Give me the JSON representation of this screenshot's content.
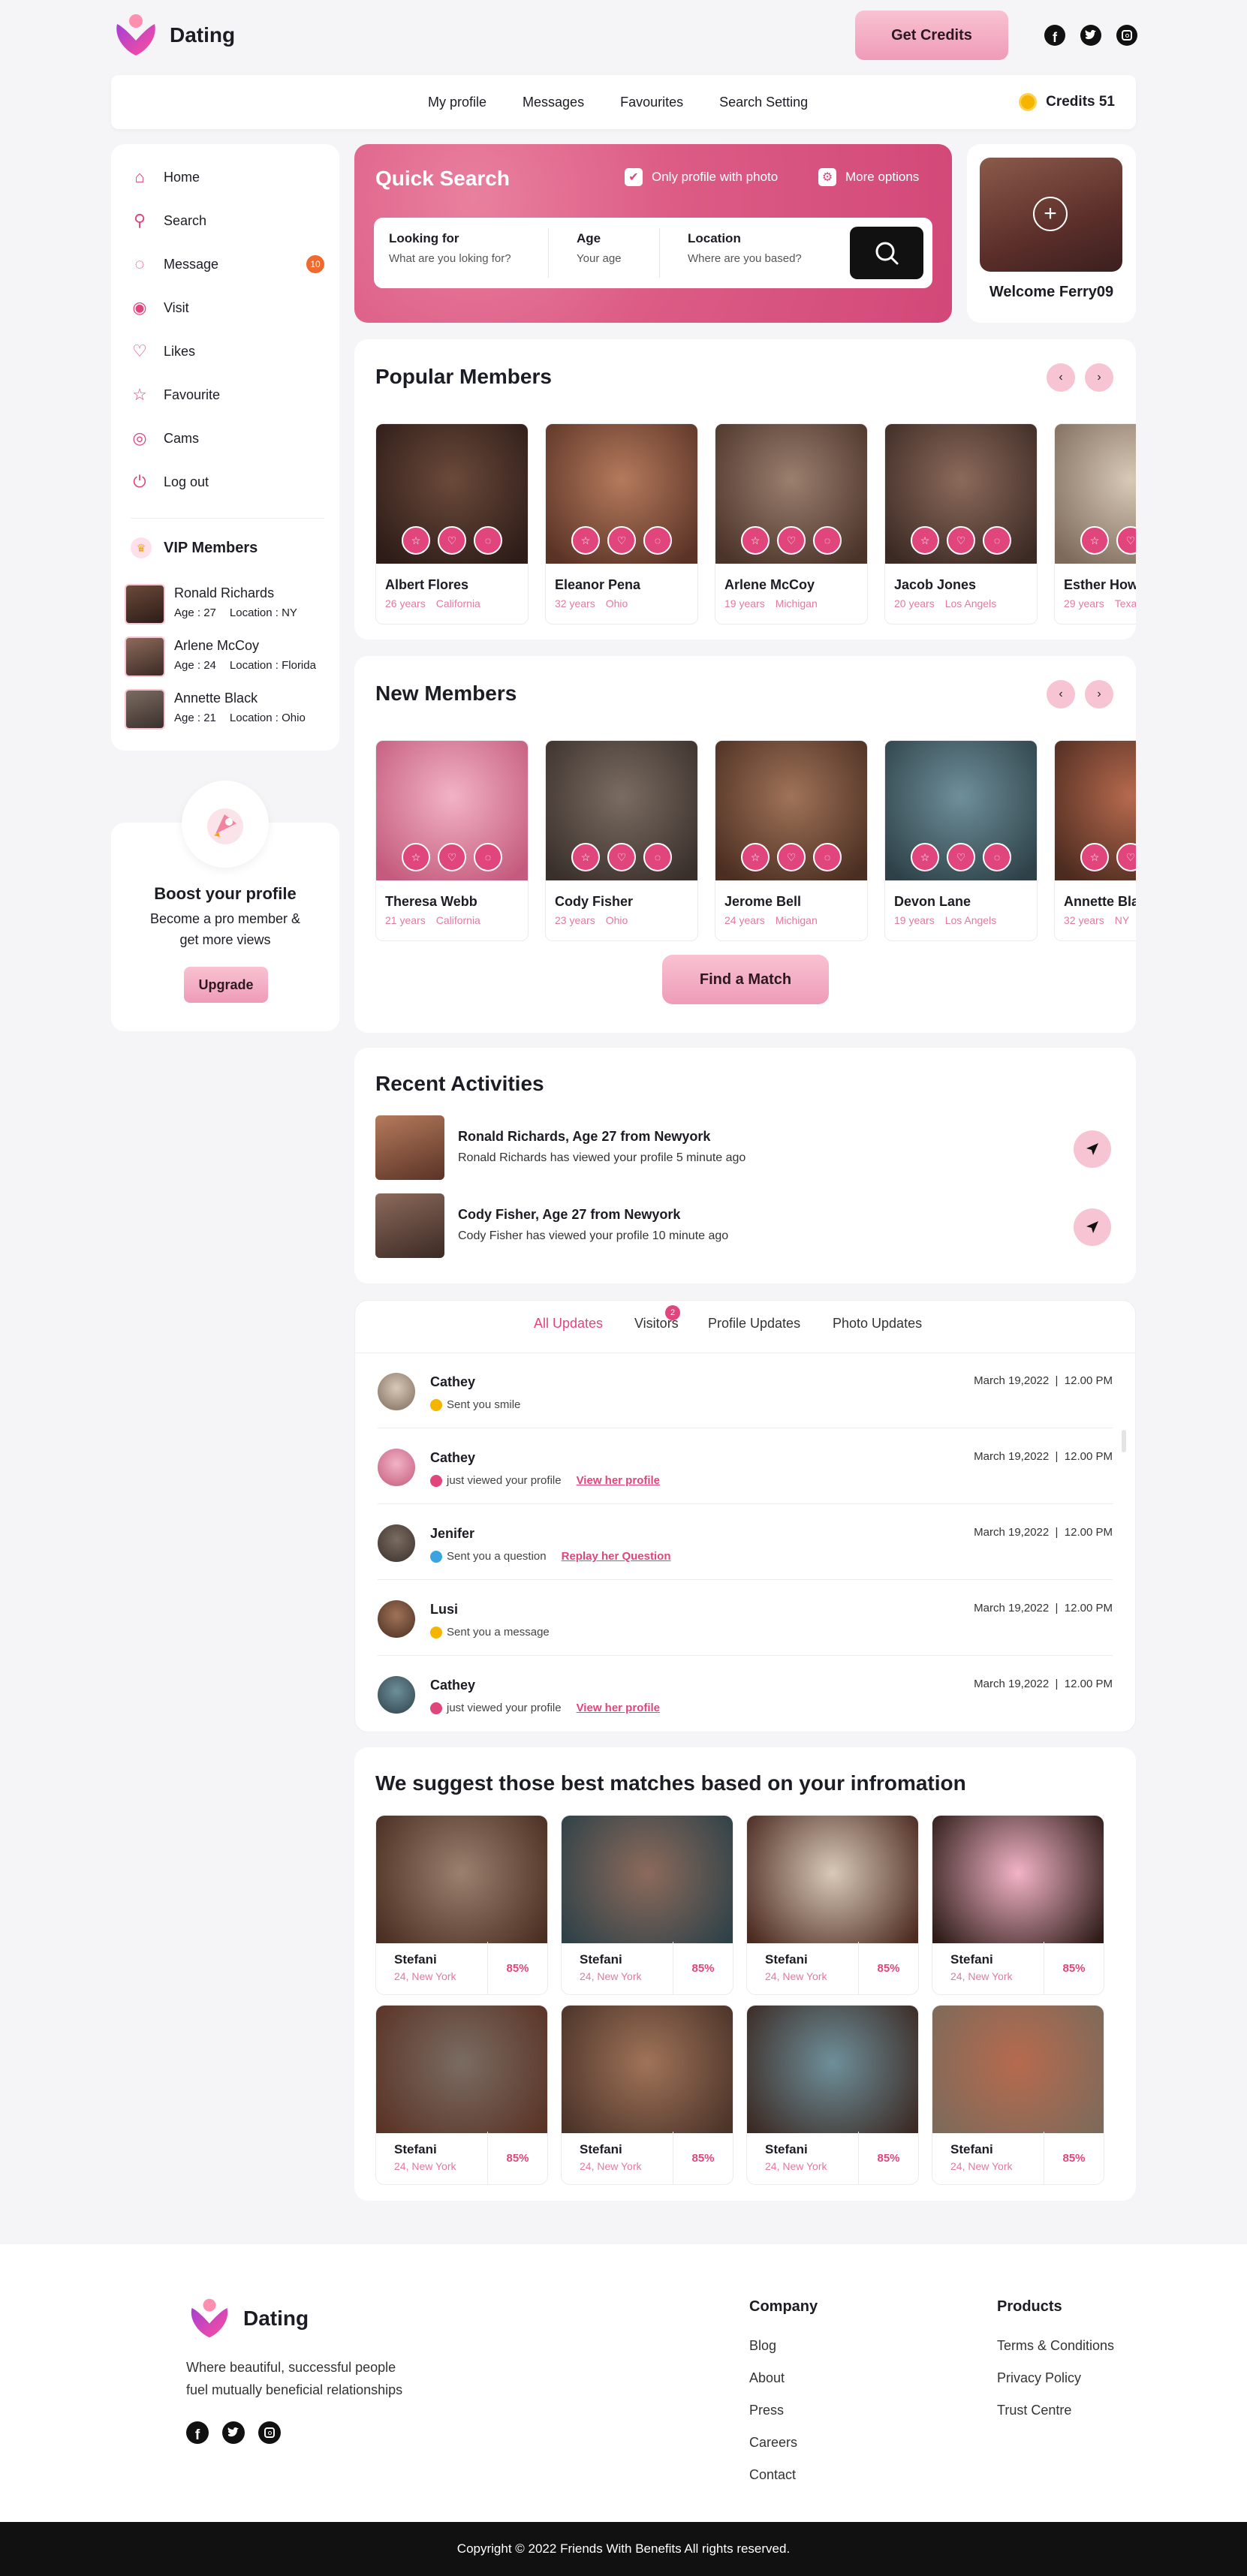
{
  "brand": {
    "name": "Dating"
  },
  "header": {
    "get_credits": "Get Credits",
    "social": [
      "facebook-icon",
      "twitter-icon",
      "instagram-icon"
    ]
  },
  "topnav": {
    "items": [
      "My profile",
      "Messages",
      "Favourites",
      "Search Setting"
    ],
    "credits": "Credits 51"
  },
  "sidebar": {
    "items": [
      {
        "label": "Home",
        "icon": "home-icon"
      },
      {
        "label": "Search",
        "icon": "search-icon"
      },
      {
        "label": "Message",
        "icon": "message-icon",
        "badge": "10"
      },
      {
        "label": "Visit",
        "icon": "eye-icon"
      },
      {
        "label": "Likes",
        "icon": "heart-icon"
      },
      {
        "label": "Favourite",
        "icon": "star-icon"
      },
      {
        "label": "Cams",
        "icon": "webcam-icon"
      },
      {
        "label": "Log out",
        "icon": "power-icon"
      }
    ],
    "vip_title": "VIP Members",
    "vip": [
      {
        "name": "Ronald Richards",
        "age": "Age : 27",
        "location": "Location : NY"
      },
      {
        "name": "Arlene McCoy",
        "age": "Age : 24",
        "location": "Location : Florida"
      },
      {
        "name": "Annette Black",
        "age": "Age : 21",
        "location": "Location : Ohio"
      }
    ]
  },
  "boost": {
    "title": "Boost your profile",
    "text1": "Become a pro member &",
    "text2": "get more views",
    "button": "Upgrade"
  },
  "quick_search": {
    "title": "Quick Search",
    "only_photo": "Only profile with photo",
    "more_options": "More options",
    "looking_label": "Looking for",
    "looking_placeholder": "What are you loking for?",
    "age_label": "Age",
    "age_placeholder": "Your age",
    "location_label": "Location",
    "location_placeholder": "Where are you based?"
  },
  "welcome": {
    "text": "Welcome Ferry09"
  },
  "popular": {
    "title": "Popular Members",
    "members": [
      {
        "name": "Albert Flores",
        "age": "26 years",
        "loc": "California"
      },
      {
        "name": "Eleanor Pena",
        "age": "32 years",
        "loc": "Ohio"
      },
      {
        "name": "Arlene McCoy",
        "age": "19 years",
        "loc": "Michigan"
      },
      {
        "name": "Jacob Jones",
        "age": "20 years",
        "loc": "Los Angels"
      },
      {
        "name": "Esther Howard",
        "age": "29 years",
        "loc": "Texas"
      }
    ]
  },
  "new_members": {
    "title": "New Members",
    "members": [
      {
        "name": "Theresa Webb",
        "age": "21 years",
        "loc": "California"
      },
      {
        "name": "Cody Fisher",
        "age": "23 years",
        "loc": "Ohio"
      },
      {
        "name": "Jerome Bell",
        "age": "24 years",
        "loc": "Michigan"
      },
      {
        "name": "Devon Lane",
        "age": "19 years",
        "loc": "Los Angels"
      },
      {
        "name": "Annette Black",
        "age": "32 years",
        "loc": "NY"
      }
    ],
    "find_match": "Find a Match"
  },
  "recent": {
    "title": "Recent Activities",
    "items": [
      {
        "title": "Ronald Richards, Age 27 from Newyork",
        "text": "Ronald Richards has viewed your profile 5 minute ago"
      },
      {
        "title": "Cody Fisher, Age 27 from Newyork",
        "text": "Cody Fisher has viewed your profile 10 minute ago"
      }
    ]
  },
  "updates": {
    "tabs": [
      "All Updates",
      "Visitors",
      "Profile Updates",
      "Photo Updates"
    ],
    "visitors_badge": "2",
    "items": [
      {
        "name": "Cathey",
        "text": "Sent you smile",
        "link": "",
        "date": "March 19,2022  |  12.00 PM"
      },
      {
        "name": "Cathey",
        "text": "just viewed your profile",
        "link": "View her profile",
        "date": "March 19,2022  |  12.00 PM"
      },
      {
        "name": "Jenifer",
        "text": "Sent you a question",
        "link": "Replay her Question",
        "date": "March 19,2022  |  12.00 PM"
      },
      {
        "name": "Lusi",
        "text": "Sent you a message",
        "link": "",
        "date": "March 19,2022  |  12.00 PM"
      },
      {
        "name": "Cathey",
        "text": "just viewed your profile",
        "link": "View her profile",
        "date": "March 19,2022  |  12.00 PM"
      }
    ]
  },
  "suggest": {
    "title": "We suggest those best matches based on your infromation",
    "items": [
      {
        "name": "Stefani",
        "place": "24, New York",
        "match": "85%"
      },
      {
        "name": "Stefani",
        "place": "24, New York",
        "match": "85%"
      },
      {
        "name": "Stefani",
        "place": "24, New York",
        "match": "85%"
      },
      {
        "name": "Stefani",
        "place": "24, New York",
        "match": "85%"
      },
      {
        "name": "Stefani",
        "place": "24, New York",
        "match": "85%"
      },
      {
        "name": "Stefani",
        "place": "24, New York",
        "match": "85%"
      },
      {
        "name": "Stefani",
        "place": "24, New York",
        "match": "85%"
      },
      {
        "name": "Stefani",
        "place": "24, New York",
        "match": "85%"
      }
    ]
  },
  "footer": {
    "tagline1": "Where beautiful, successful people",
    "tagline2": "fuel mutually beneficial relationships",
    "company_title": "Company",
    "company": [
      "Blog",
      "About",
      "Press",
      "Careers",
      "Contact"
    ],
    "products_title": "Products",
    "products": [
      "Terms & Conditions",
      "Privacy Policy",
      "Trust Centre"
    ],
    "copyright": "Copyright © 2022 Friends With Benefits All rights reserved."
  },
  "colors": {
    "accent": "#e0457b",
    "pink_light": "#f7c4d3",
    "dark": "#111111"
  }
}
